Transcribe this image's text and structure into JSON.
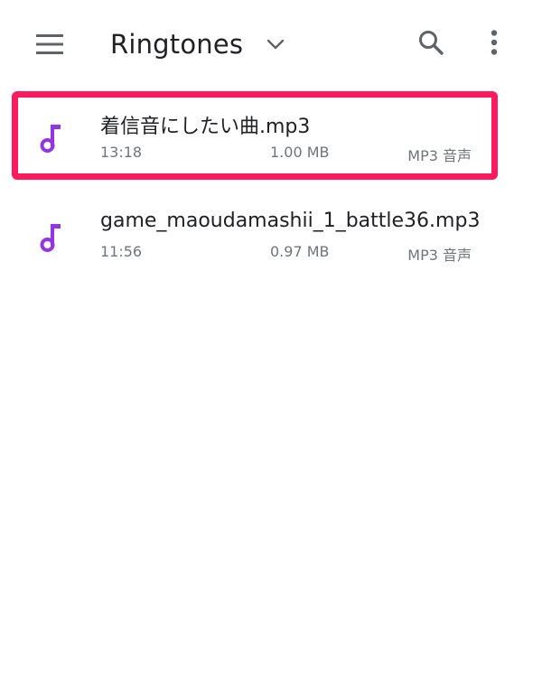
{
  "toolbar": {
    "menu_icon": "hamburger-menu-icon",
    "title": "Ringtones",
    "dropdown_icon": "chevron-down-icon",
    "search_icon": "search-icon",
    "more_icon": "more-vert-icon"
  },
  "colors": {
    "accent_music": "#9334e6",
    "highlight_border": "#ff1a5e",
    "text_primary": "#202124",
    "text_secondary": "#70757a"
  },
  "files": [
    {
      "name": "着信音にしたい曲.mp3",
      "time": "13:18",
      "size": "1.00 MB",
      "type": "MP3 音声",
      "icon": "music-note-icon",
      "highlighted": true
    },
    {
      "name": "game_maoudamashii_1_battle36.mp3",
      "time": "11:56",
      "size": "0.97 MB",
      "type": "MP3 音声",
      "icon": "music-note-icon",
      "highlighted": false
    }
  ]
}
